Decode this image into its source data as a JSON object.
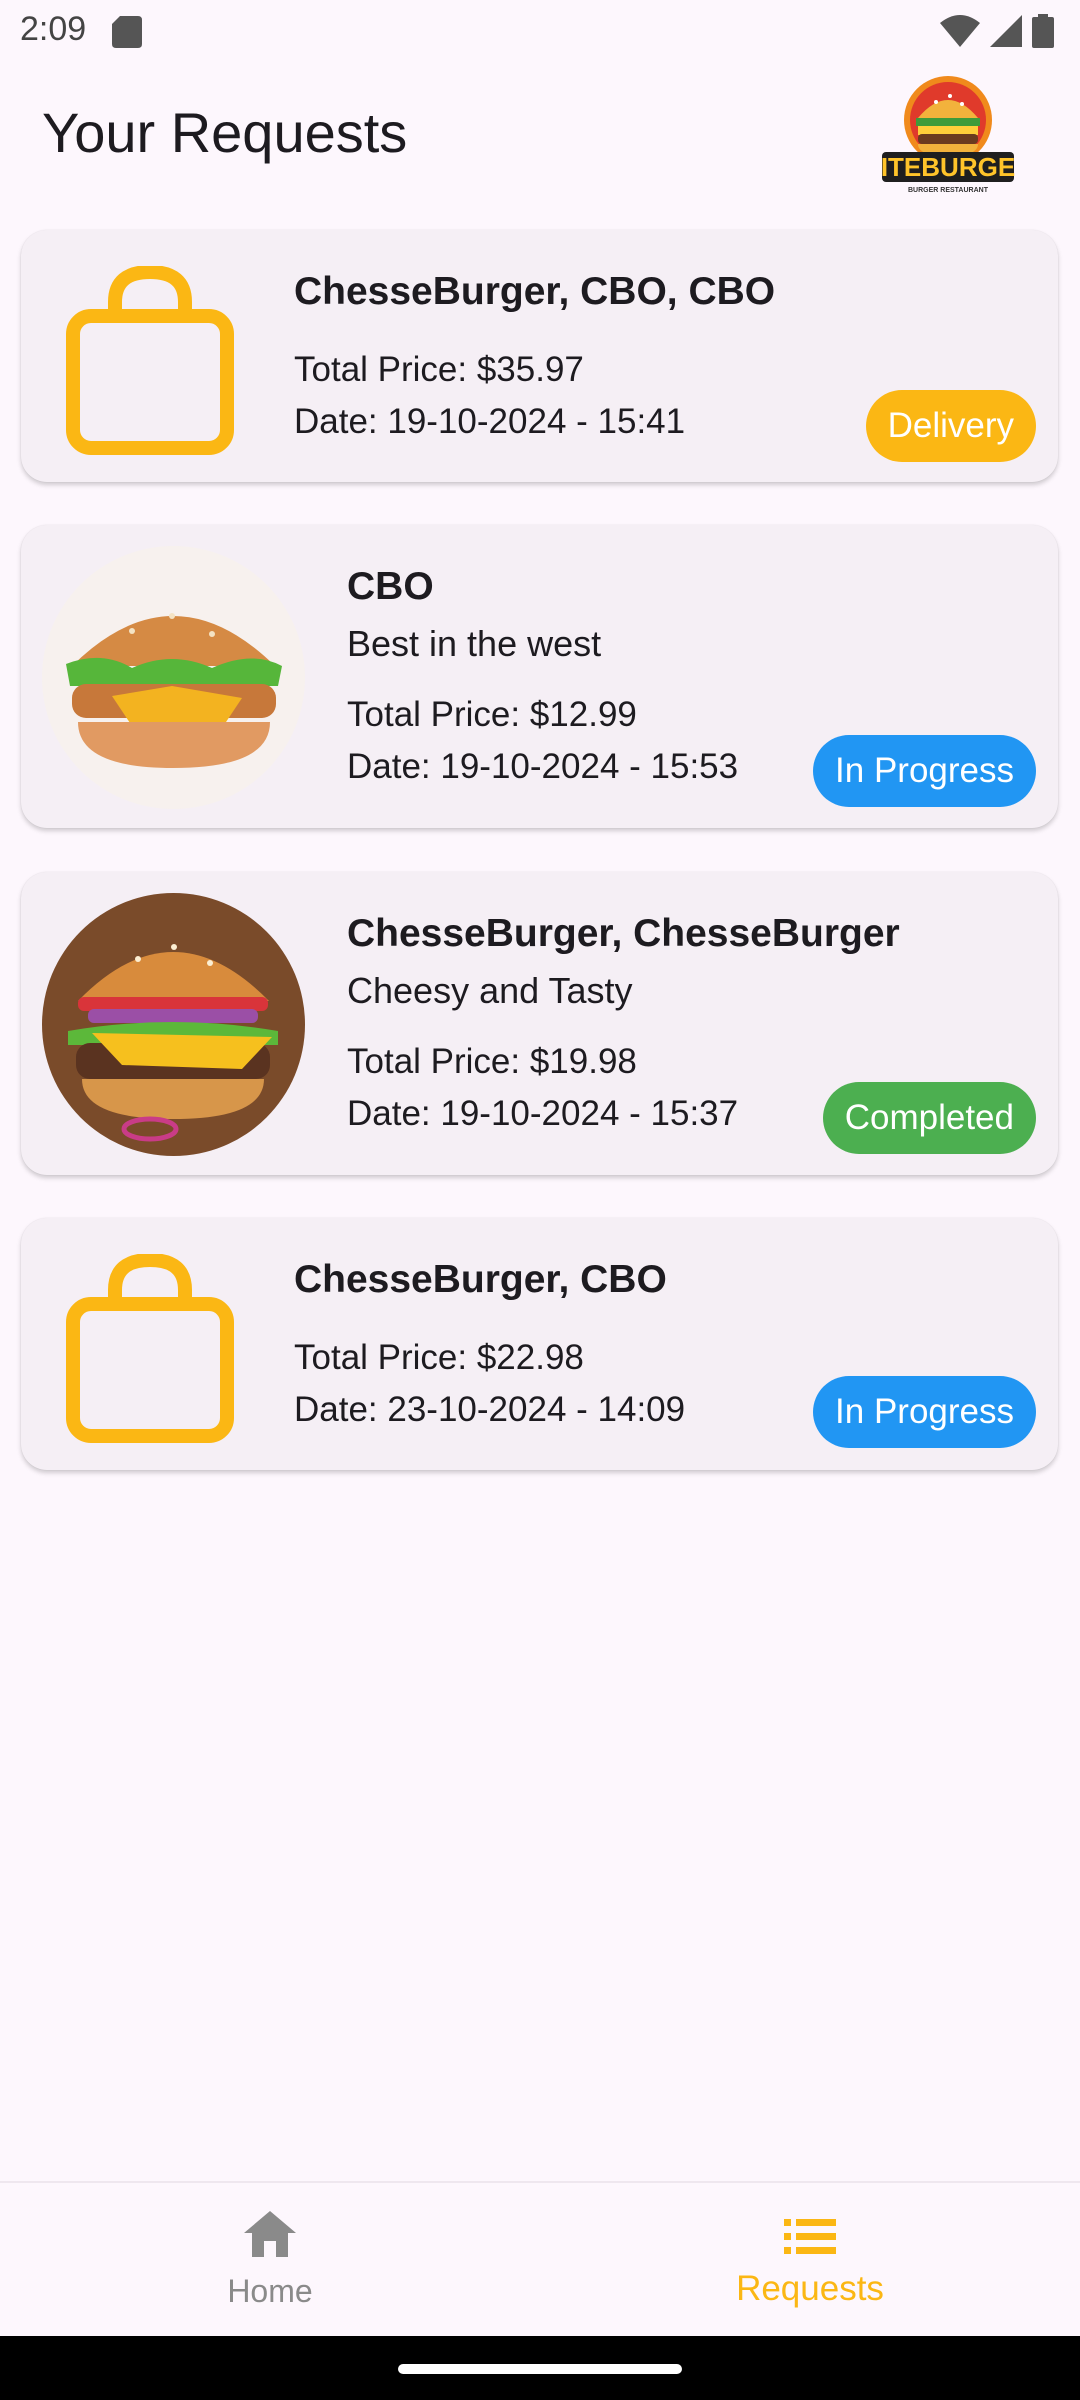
{
  "status_bar": {
    "time": "2:09",
    "icons": [
      "sd-card-icon",
      "wifi-icon",
      "cell-signal-icon",
      "battery-icon"
    ]
  },
  "header": {
    "title": "Your Requests",
    "logo_text": "BITEBURGER",
    "logo_tagline": "BURGER RESTAURANT"
  },
  "orders": [
    {
      "title": "ChesseBurger, CBO, CBO",
      "subtitle": "",
      "price": "Total Price: $35.97",
      "date": "Date: 19-10-2024 - 15:41",
      "status": "Delivery",
      "status_color": "#fbb714",
      "image": "bag-icon"
    },
    {
      "title": "CBO",
      "subtitle": "Best in the west",
      "price": "Total Price: $12.99",
      "date": "Date: 19-10-2024 - 15:53",
      "status": "In Progress",
      "status_color": "#2196f3",
      "image": "chicken-burger-image"
    },
    {
      "title": "ChesseBurger, ChesseBurger",
      "subtitle": "Cheesy and Tasty",
      "price": "Total Price: $19.98",
      "date": "Date: 19-10-2024 - 15:37",
      "status": "Completed",
      "status_color": "#4caf50",
      "image": "cheeseburger-image"
    },
    {
      "title": "ChesseBurger, CBO",
      "subtitle": "",
      "price": "Total Price: $22.98",
      "date": "Date: 23-10-2024 - 14:09",
      "status": "In Progress",
      "status_color": "#2196f3",
      "image": "bag-icon"
    }
  ],
  "bottom_nav": {
    "items": [
      {
        "label": "Home",
        "icon": "home-icon",
        "active": false
      },
      {
        "label": "Requests",
        "icon": "list-icon",
        "active": true
      }
    ],
    "active_color": "#fbb714",
    "inactive_color": "#8a8a8a"
  }
}
